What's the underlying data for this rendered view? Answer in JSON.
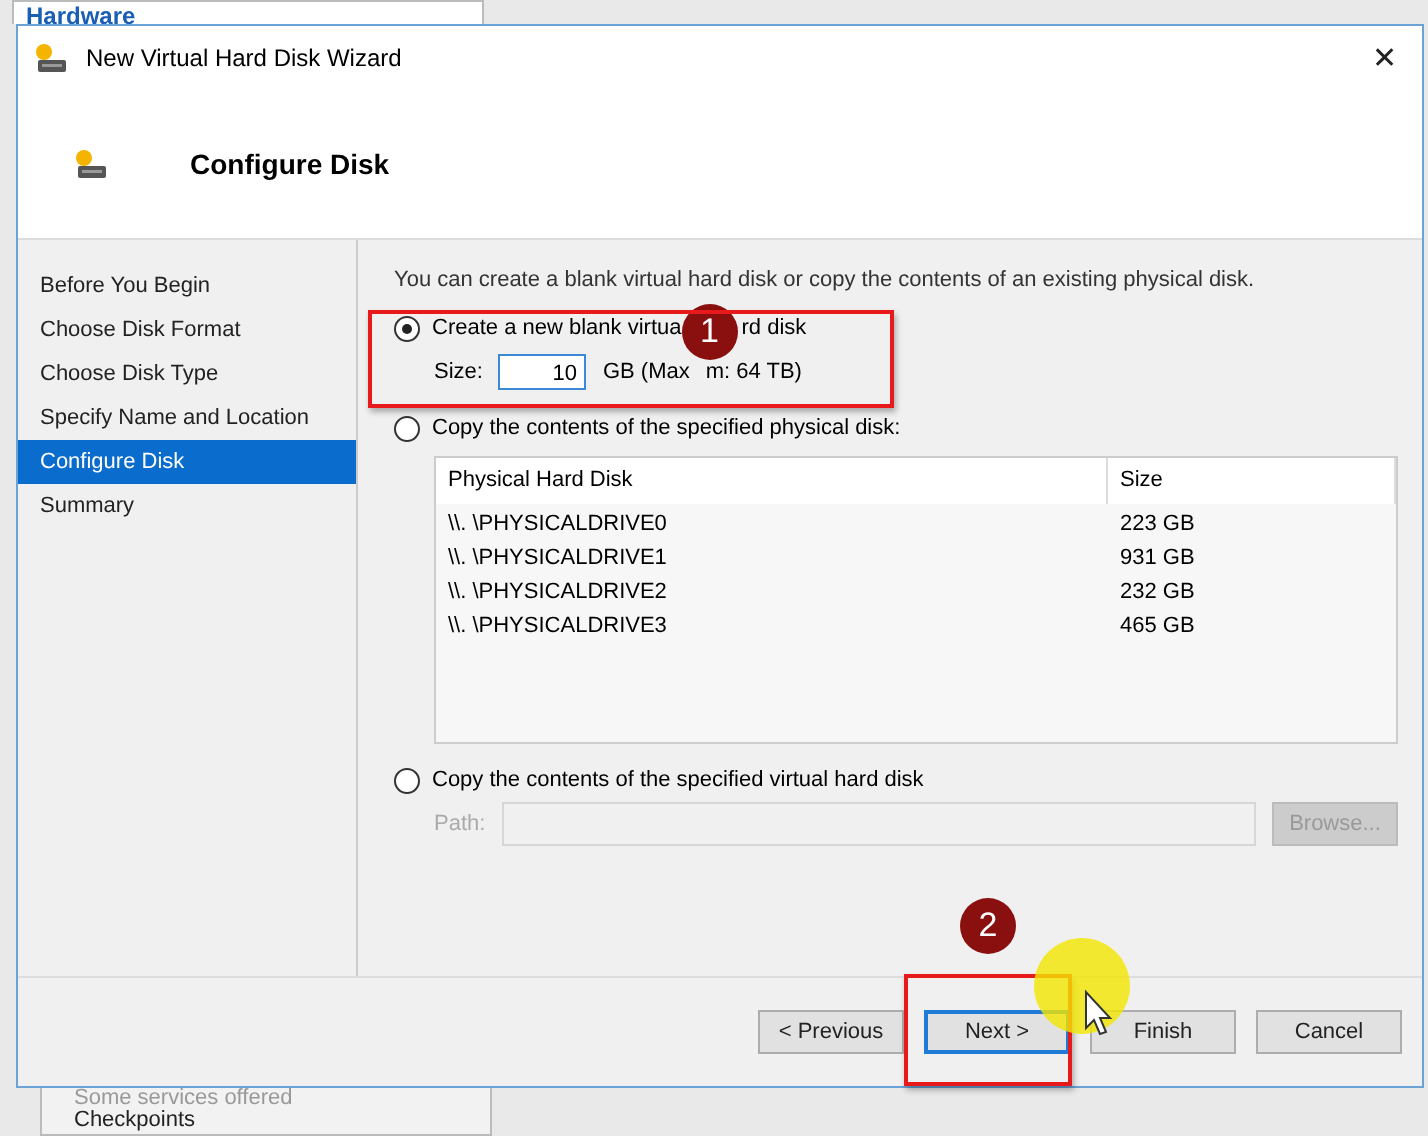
{
  "background": {
    "top_item": "Hardware",
    "bottom_items": [
      {
        "label": "Some services offered"
      },
      {
        "label": "Checkpoints"
      }
    ]
  },
  "window": {
    "title": "New Virtual Hard Disk Wizard",
    "close": "✕"
  },
  "header": {
    "title": "Configure Disk"
  },
  "steps": [
    {
      "label": "Before You Begin",
      "selected": false
    },
    {
      "label": "Choose Disk Format",
      "selected": false
    },
    {
      "label": "Choose Disk Type",
      "selected": false
    },
    {
      "label": "Specify Name and Location",
      "selected": false
    },
    {
      "label": "Configure Disk",
      "selected": true
    },
    {
      "label": "Summary",
      "selected": false
    }
  ],
  "intro": "You can create a blank virtual hard disk or copy the contents of an existing physical disk.",
  "options": [
    {
      "kind": "size",
      "label": "Create a new blank virtua",
      "label_tail": "rd disk",
      "selected": true,
      "field_label": "Size:",
      "value": "10",
      "unit": "GB (Max",
      "unit_tail": "m: 64 TB)"
    },
    {
      "kind": "table",
      "label": "Copy the contents of the specified physical disk:",
      "selected": false,
      "columns": [
        "Physical Hard Disk",
        "Size"
      ],
      "rows": [
        [
          "\\\\. \\PHYSICALDRIVE0",
          "223 GB"
        ],
        [
          "\\\\. \\PHYSICALDRIVE1",
          "931 GB"
        ],
        [
          "\\\\. \\PHYSICALDRIVE2",
          "232 GB"
        ],
        [
          "\\\\. \\PHYSICALDRIVE3",
          "465 GB"
        ]
      ]
    },
    {
      "kind": "path",
      "label": "Copy the contents of the specified virtual hard disk",
      "selected": false,
      "field_label": "Path:",
      "button": "Browse...",
      "disabled": true
    }
  ],
  "buttons": [
    {
      "label": "< Previous",
      "focused": false
    },
    {
      "label": "Next >",
      "focused": true
    },
    {
      "label": "Finish",
      "focused": false
    },
    {
      "label": "Cancel",
      "focused": false
    }
  ],
  "annotations": [
    {
      "label": "1"
    },
    {
      "label": "2"
    }
  ]
}
